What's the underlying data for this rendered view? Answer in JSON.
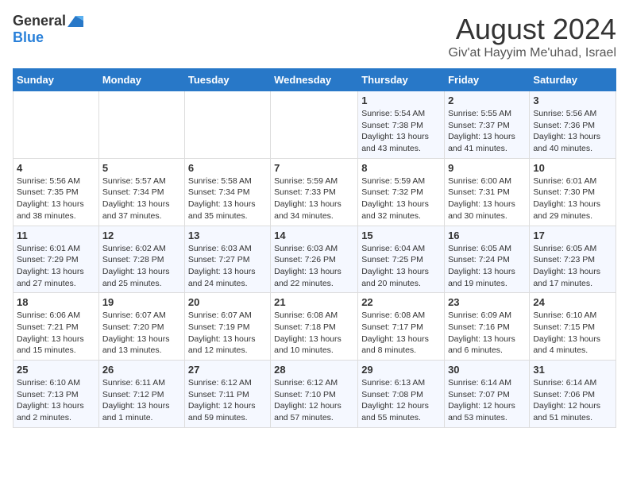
{
  "header": {
    "logo_general": "General",
    "logo_blue": "Blue",
    "month": "August 2024",
    "location": "Giv'at Hayyim Me'uhad, Israel"
  },
  "weekdays": [
    "Sunday",
    "Monday",
    "Tuesday",
    "Wednesday",
    "Thursday",
    "Friday",
    "Saturday"
  ],
  "weeks": [
    [
      {
        "day": "",
        "info": ""
      },
      {
        "day": "",
        "info": ""
      },
      {
        "day": "",
        "info": ""
      },
      {
        "day": "",
        "info": ""
      },
      {
        "day": "1",
        "info": "Sunrise: 5:54 AM\nSunset: 7:38 PM\nDaylight: 13 hours\nand 43 minutes."
      },
      {
        "day": "2",
        "info": "Sunrise: 5:55 AM\nSunset: 7:37 PM\nDaylight: 13 hours\nand 41 minutes."
      },
      {
        "day": "3",
        "info": "Sunrise: 5:56 AM\nSunset: 7:36 PM\nDaylight: 13 hours\nand 40 minutes."
      }
    ],
    [
      {
        "day": "4",
        "info": "Sunrise: 5:56 AM\nSunset: 7:35 PM\nDaylight: 13 hours\nand 38 minutes."
      },
      {
        "day": "5",
        "info": "Sunrise: 5:57 AM\nSunset: 7:34 PM\nDaylight: 13 hours\nand 37 minutes."
      },
      {
        "day": "6",
        "info": "Sunrise: 5:58 AM\nSunset: 7:34 PM\nDaylight: 13 hours\nand 35 minutes."
      },
      {
        "day": "7",
        "info": "Sunrise: 5:59 AM\nSunset: 7:33 PM\nDaylight: 13 hours\nand 34 minutes."
      },
      {
        "day": "8",
        "info": "Sunrise: 5:59 AM\nSunset: 7:32 PM\nDaylight: 13 hours\nand 32 minutes."
      },
      {
        "day": "9",
        "info": "Sunrise: 6:00 AM\nSunset: 7:31 PM\nDaylight: 13 hours\nand 30 minutes."
      },
      {
        "day": "10",
        "info": "Sunrise: 6:01 AM\nSunset: 7:30 PM\nDaylight: 13 hours\nand 29 minutes."
      }
    ],
    [
      {
        "day": "11",
        "info": "Sunrise: 6:01 AM\nSunset: 7:29 PM\nDaylight: 13 hours\nand 27 minutes."
      },
      {
        "day": "12",
        "info": "Sunrise: 6:02 AM\nSunset: 7:28 PM\nDaylight: 13 hours\nand 25 minutes."
      },
      {
        "day": "13",
        "info": "Sunrise: 6:03 AM\nSunset: 7:27 PM\nDaylight: 13 hours\nand 24 minutes."
      },
      {
        "day": "14",
        "info": "Sunrise: 6:03 AM\nSunset: 7:26 PM\nDaylight: 13 hours\nand 22 minutes."
      },
      {
        "day": "15",
        "info": "Sunrise: 6:04 AM\nSunset: 7:25 PM\nDaylight: 13 hours\nand 20 minutes."
      },
      {
        "day": "16",
        "info": "Sunrise: 6:05 AM\nSunset: 7:24 PM\nDaylight: 13 hours\nand 19 minutes."
      },
      {
        "day": "17",
        "info": "Sunrise: 6:05 AM\nSunset: 7:23 PM\nDaylight: 13 hours\nand 17 minutes."
      }
    ],
    [
      {
        "day": "18",
        "info": "Sunrise: 6:06 AM\nSunset: 7:21 PM\nDaylight: 13 hours\nand 15 minutes."
      },
      {
        "day": "19",
        "info": "Sunrise: 6:07 AM\nSunset: 7:20 PM\nDaylight: 13 hours\nand 13 minutes."
      },
      {
        "day": "20",
        "info": "Sunrise: 6:07 AM\nSunset: 7:19 PM\nDaylight: 13 hours\nand 12 minutes."
      },
      {
        "day": "21",
        "info": "Sunrise: 6:08 AM\nSunset: 7:18 PM\nDaylight: 13 hours\nand 10 minutes."
      },
      {
        "day": "22",
        "info": "Sunrise: 6:08 AM\nSunset: 7:17 PM\nDaylight: 13 hours\nand 8 minutes."
      },
      {
        "day": "23",
        "info": "Sunrise: 6:09 AM\nSunset: 7:16 PM\nDaylight: 13 hours\nand 6 minutes."
      },
      {
        "day": "24",
        "info": "Sunrise: 6:10 AM\nSunset: 7:15 PM\nDaylight: 13 hours\nand 4 minutes."
      }
    ],
    [
      {
        "day": "25",
        "info": "Sunrise: 6:10 AM\nSunset: 7:13 PM\nDaylight: 13 hours\nand 2 minutes."
      },
      {
        "day": "26",
        "info": "Sunrise: 6:11 AM\nSunset: 7:12 PM\nDaylight: 13 hours\nand 1 minute."
      },
      {
        "day": "27",
        "info": "Sunrise: 6:12 AM\nSunset: 7:11 PM\nDaylight: 12 hours\nand 59 minutes."
      },
      {
        "day": "28",
        "info": "Sunrise: 6:12 AM\nSunset: 7:10 PM\nDaylight: 12 hours\nand 57 minutes."
      },
      {
        "day": "29",
        "info": "Sunrise: 6:13 AM\nSunset: 7:08 PM\nDaylight: 12 hours\nand 55 minutes."
      },
      {
        "day": "30",
        "info": "Sunrise: 6:14 AM\nSunset: 7:07 PM\nDaylight: 12 hours\nand 53 minutes."
      },
      {
        "day": "31",
        "info": "Sunrise: 6:14 AM\nSunset: 7:06 PM\nDaylight: 12 hours\nand 51 minutes."
      }
    ]
  ]
}
